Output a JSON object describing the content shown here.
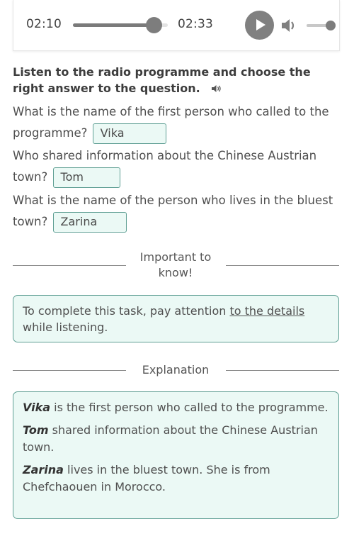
{
  "player": {
    "current_time": "02:10",
    "duration": "02:33",
    "progress_fraction": 0.85,
    "volume_fraction": 1.0,
    "play_icon": "play-icon",
    "volume_icon": "volume-icon"
  },
  "task": {
    "instruction": "Listen to the radio programme and choose the right answer to the question.",
    "instruction_icon": "speaker-icon",
    "questions": [
      {
        "text": "What is the name of the first person who called to the programme?",
        "answer": "Vika"
      },
      {
        "text": "Who shared information about the Chinese Austrian town?",
        "answer": "Tom"
      },
      {
        "text": "What is the name of the person who lives in the bluest town?",
        "answer": "Zarina"
      }
    ]
  },
  "important": {
    "heading_line1": "Important to",
    "heading_line2": "know!",
    "text_before": "To complete this task, pay attention ",
    "link_text": "to the details",
    "text_after": " while listening."
  },
  "explanation": {
    "heading": "Explanation",
    "items": [
      {
        "name": "Vika",
        "text": " is the first person who called to the programme."
      },
      {
        "name": "Tom",
        "text": " shared information about the Chinese Austrian town."
      },
      {
        "name": "Zarina",
        "text": " lives in the bluest town. She is from Chefchaouen in Morocco."
      }
    ]
  },
  "colors": {
    "accent_border": "#5f9f94",
    "accent_fill": "#ebf9f5",
    "control_gray": "#7d7d7d"
  }
}
